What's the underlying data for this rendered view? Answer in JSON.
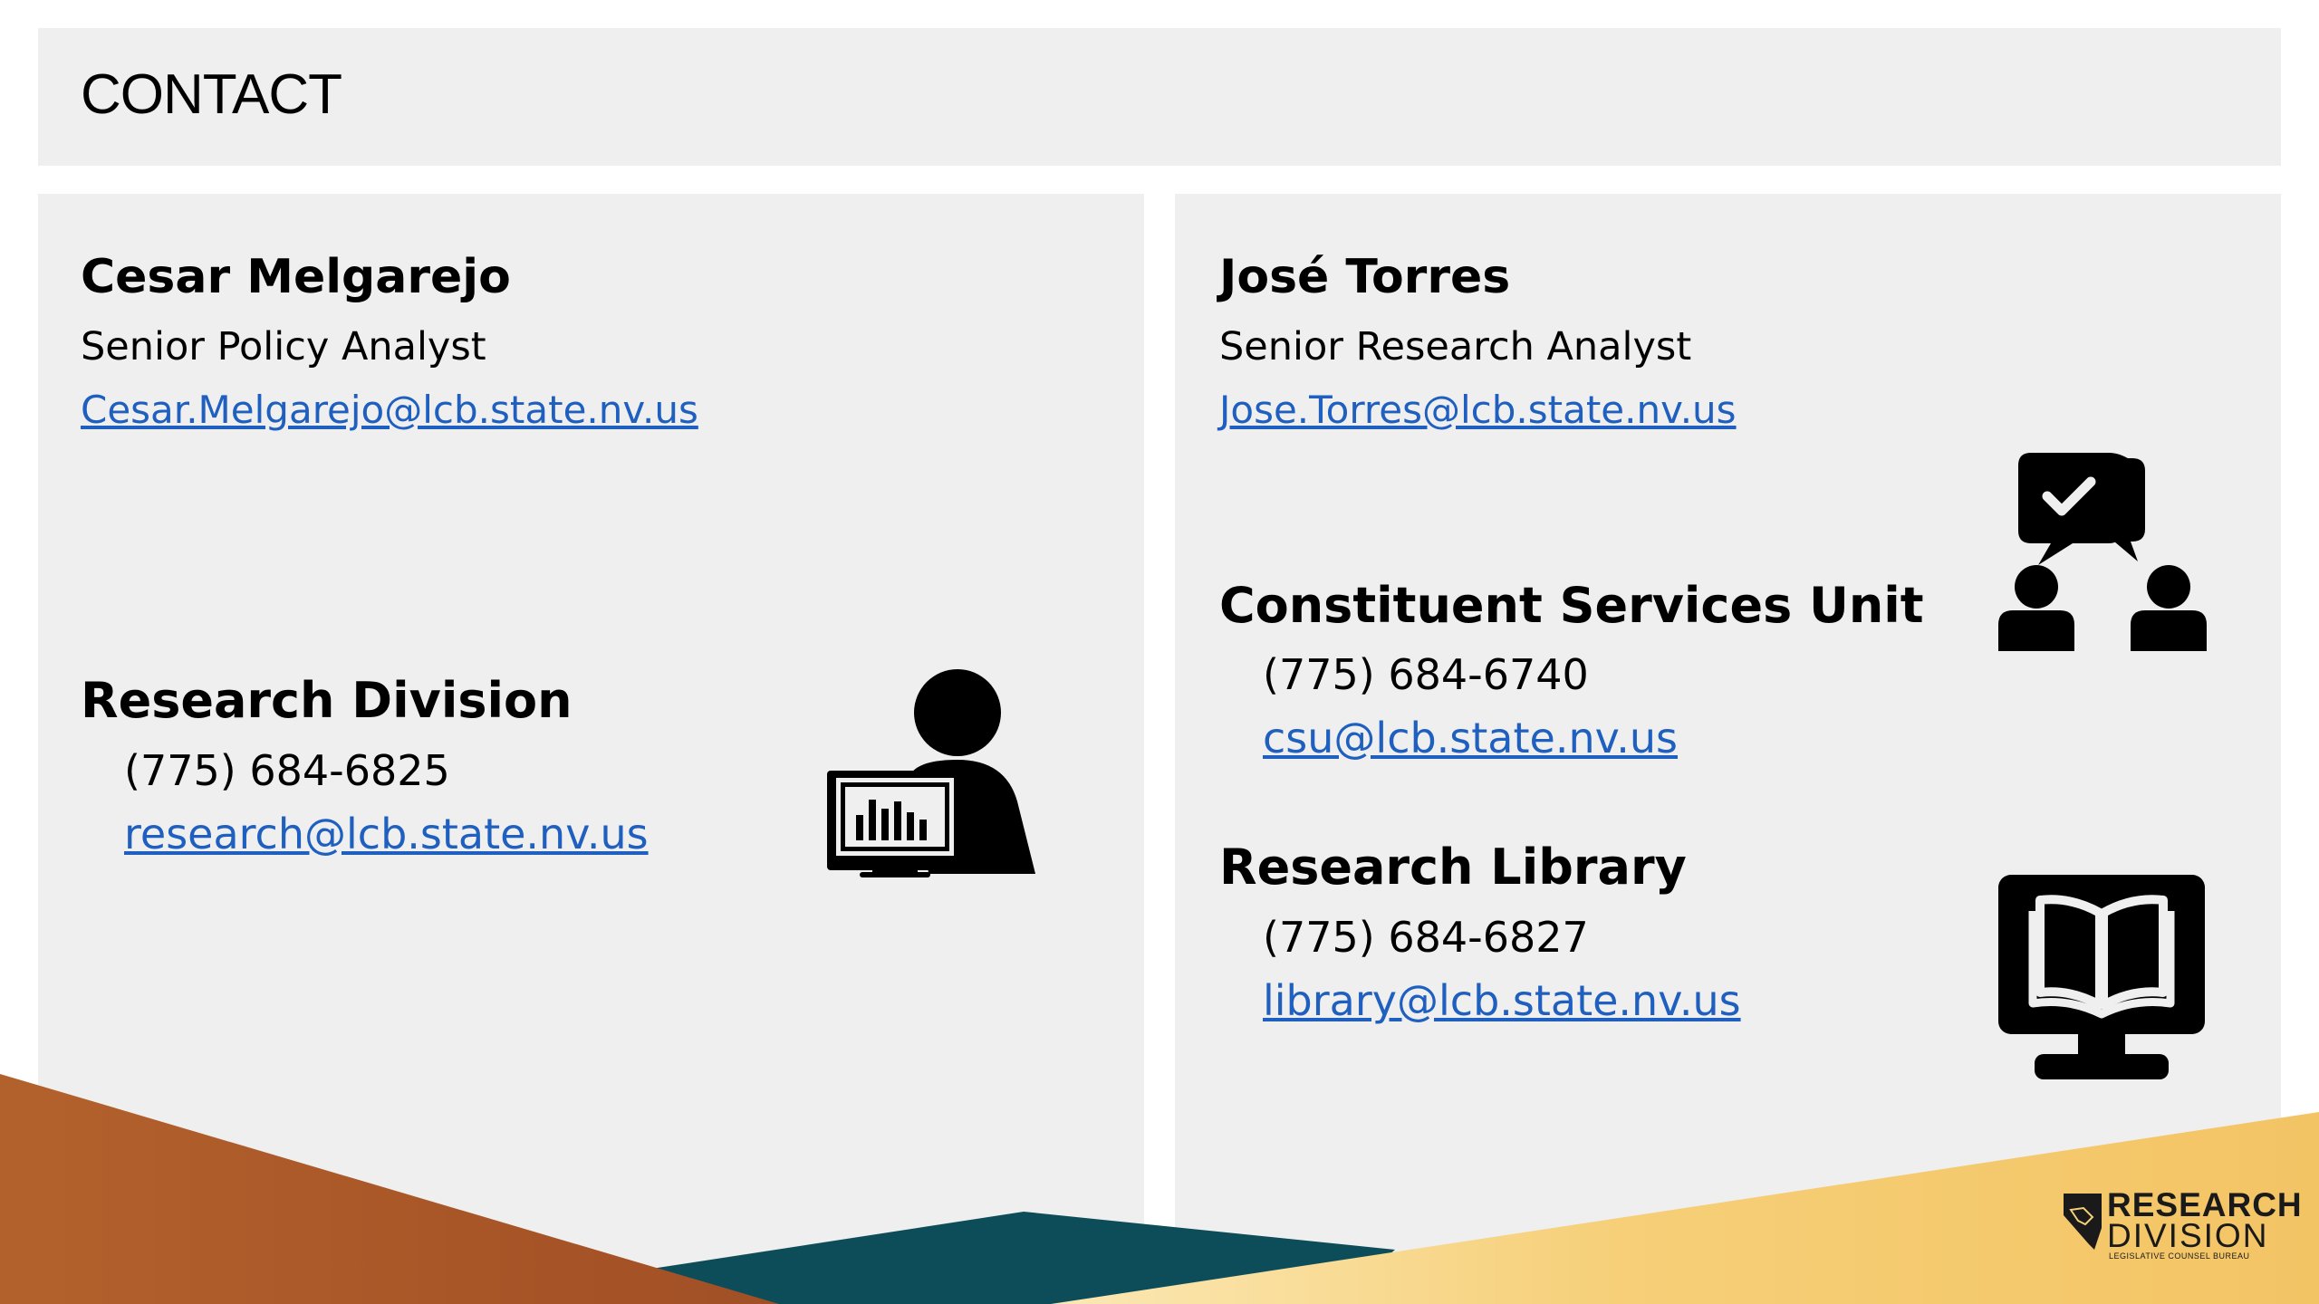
{
  "page": {
    "title": "CONTACT"
  },
  "left": {
    "person": {
      "name": "Cesar Melgarejo",
      "role": "Senior Policy Analyst",
      "email": "Cesar.Melgarejo@lcb.state.nv.us"
    },
    "division": {
      "title": "Research Division",
      "phone": "(775) 684-6825",
      "email": "research@lcb.state.nv.us",
      "icon": "analyst-computer-icon"
    }
  },
  "right": {
    "person": {
      "name": "José Torres",
      "role": "Senior Research Analyst",
      "email": "Jose.Torres@lcb.state.nv.us"
    },
    "csu": {
      "title": "Constituent Services Unit",
      "phone": "(775) 684-6740",
      "email": "csu@lcb.state.nv.us",
      "icon": "conversation-people-icon"
    },
    "library": {
      "title": "Research Library",
      "phone": "(775) 684-6827",
      "email": "library@lcb.state.nv.us",
      "icon": "book-monitor-icon"
    }
  },
  "logo": {
    "line1": "RESEARCH",
    "line2": "DIVISION",
    "line3": "LEGISLATIVE COUNSEL BUREAU"
  },
  "colors": {
    "panel_bg": "#efefef",
    "link": "#1f5fbf",
    "accent_orange": "#b4622a",
    "accent_teal": "#0d4d5a",
    "accent_gold": "#f6c96b"
  }
}
